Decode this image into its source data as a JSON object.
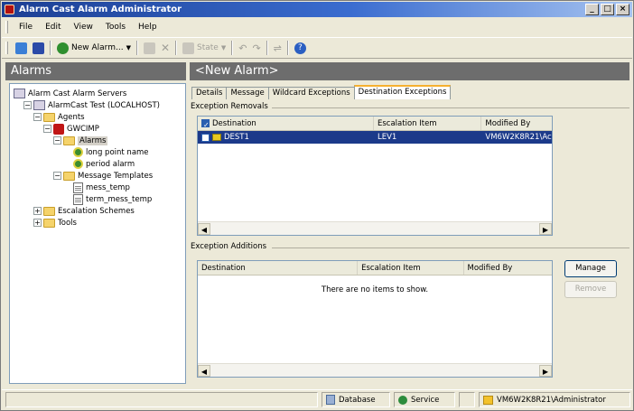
{
  "window": {
    "title": "Alarm Cast Alarm Administrator",
    "buttons": [
      "_",
      "□",
      "×"
    ]
  },
  "menu": [
    "File",
    "Edit",
    "View",
    "Tools",
    "Help"
  ],
  "toolbar": {
    "new_alarm": "New Alarm...",
    "state": "State"
  },
  "left": {
    "header": "Alarms",
    "tree": [
      {
        "label": "Alarm Cast Alarm Servers",
        "icon": "servers-icon",
        "level": 0,
        "toggle": ""
      },
      {
        "label": "AlarmCast Test (LOCALHOST)",
        "icon": "server-icon",
        "level": 1,
        "toggle": "−"
      },
      {
        "label": "Agents",
        "icon": "folder-icon",
        "level": 2,
        "toggle": "−"
      },
      {
        "label": "GWCIMP",
        "icon": "agent-icon",
        "level": 3,
        "toggle": "−"
      },
      {
        "label": "Alarms",
        "icon": "folder-icon",
        "level": 4,
        "toggle": "−",
        "selected": true
      },
      {
        "label": "long point name",
        "icon": "alarm-icon",
        "level": 5,
        "toggle": ""
      },
      {
        "label": "period alarm",
        "icon": "alarm-icon",
        "level": 5,
        "toggle": ""
      },
      {
        "label": "Message Templates",
        "icon": "folder-icon",
        "level": 4,
        "toggle": "−"
      },
      {
        "label": "mess_temp",
        "icon": "template-icon",
        "level": 5,
        "toggle": ""
      },
      {
        "label": "term_mess_temp",
        "icon": "template-icon",
        "level": 5,
        "toggle": ""
      },
      {
        "label": "Escalation Schemes",
        "icon": "folder-icon",
        "level": 2,
        "toggle": "+"
      },
      {
        "label": "Tools",
        "icon": "folder-icon",
        "level": 2,
        "toggle": "+"
      }
    ]
  },
  "right": {
    "header": "<New Alarm>",
    "tabs": [
      "Details",
      "Message",
      "Wildcard Exceptions",
      "Destination Exceptions"
    ],
    "active_tab": 3,
    "removals": {
      "label": "Exception Removals",
      "columns": [
        "Destination",
        "Escalation Item",
        "Modified By"
      ],
      "rows": [
        {
          "destination": "DEST1",
          "item": "LEV1",
          "modified": "VM6W2K8R21\\Ac"
        }
      ]
    },
    "additions": {
      "label": "Exception Additions",
      "columns": [
        "Destination",
        "Escalation Item",
        "Modified By"
      ],
      "empty": "There are no items to show."
    },
    "manage_label": "Manage",
    "remove_label": "Remove"
  },
  "status": {
    "database": "Database",
    "service": "Service",
    "user": "VM6W2K8R21\\Administrator"
  }
}
